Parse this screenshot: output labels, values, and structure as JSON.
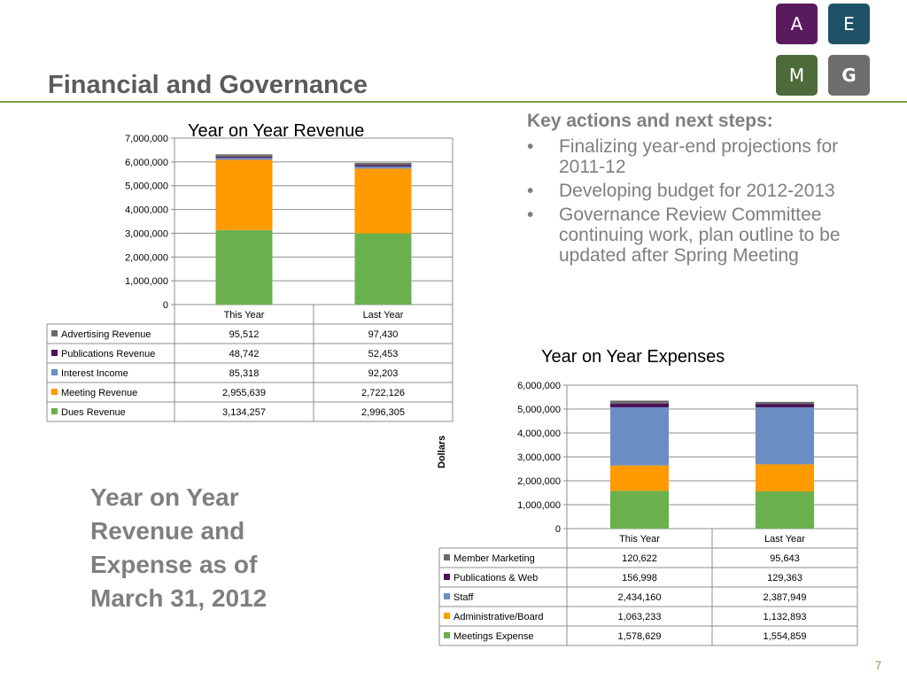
{
  "logo": {
    "tiles": [
      {
        "letter": "A",
        "color": "#5a1a5e"
      },
      {
        "letter": "E",
        "color": "#1f5268"
      },
      {
        "letter": "M",
        "color": "#4d6b3a"
      },
      {
        "letter": "G",
        "color": "#6e6e6e"
      }
    ]
  },
  "page": {
    "title": "Financial and Governance",
    "page_number": "7",
    "accent_color": "#77a33f"
  },
  "key_actions": {
    "heading": "Key actions and next steps:",
    "bullets": [
      "Finalizing year-end projections for 2011-12",
      "Developing budget for 2012-2013",
      "Governance Review Committee continuing work, plan outline to be updated after Spring Meeting"
    ]
  },
  "caption": "Year on Year Revenue and Expense as of March 31, 2012",
  "chart_data": [
    {
      "type": "bar",
      "stacked": true,
      "title": "Year on Year Revenue",
      "ylabel": "",
      "xlabel": "",
      "ylim": [
        0,
        7000000
      ],
      "yticks": [
        0,
        1000000,
        2000000,
        3000000,
        4000000,
        5000000,
        6000000,
        7000000
      ],
      "ytick_labels": [
        "0",
        "1,000,000",
        "2,000,000",
        "3,000,000",
        "4,000,000",
        "5,000,000",
        "6,000,000",
        "7,000,000"
      ],
      "grid": true,
      "legend": "data-table",
      "categories": [
        "This Year",
        "Last Year"
      ],
      "series": [
        {
          "name": "Dues Revenue",
          "color": "#6ab04c",
          "values": [
            3134257,
            2996305
          ],
          "labels": [
            "3,134,257",
            "2,996,305"
          ]
        },
        {
          "name": "Meeting Revenue",
          "color": "#ff9a00",
          "values": [
            2955639,
            2722126
          ],
          "labels": [
            "2,955,639",
            "2,722,126"
          ]
        },
        {
          "name": "Interest Income",
          "color": "#6a8dc3",
          "values": [
            85318,
            92203
          ],
          "labels": [
            "85,318",
            "92,203"
          ]
        },
        {
          "name": "Publications Revenue",
          "color": "#4b1055",
          "values": [
            48742,
            52453
          ],
          "labels": [
            "48,742",
            "52,453"
          ]
        },
        {
          "name": "Advertising Revenue",
          "color": "#6b6b6b",
          "values": [
            95512,
            97430
          ],
          "labels": [
            "95,512",
            "97,430"
          ]
        }
      ]
    },
    {
      "type": "bar",
      "stacked": true,
      "title": "Year on Year Expenses",
      "ylabel": "Dollars",
      "xlabel": "",
      "ylim": [
        0,
        6000000
      ],
      "yticks": [
        0,
        1000000,
        2000000,
        3000000,
        4000000,
        5000000,
        6000000
      ],
      "ytick_labels": [
        "0",
        "1,000,000",
        "2,000,000",
        "3,000,000",
        "4,000,000",
        "5,000,000",
        "6,000,000"
      ],
      "grid": true,
      "legend": "data-table",
      "categories": [
        "This Year",
        "Last Year"
      ],
      "series": [
        {
          "name": "Meetings Expense",
          "color": "#6ab04c",
          "values": [
            1578629,
            1554859
          ],
          "labels": [
            "1,578,629",
            "1,554,859"
          ]
        },
        {
          "name": "Administrative/Board",
          "color": "#ff9a00",
          "values": [
            1063233,
            1132893
          ],
          "labels": [
            "1,063,233",
            "1,132,893"
          ]
        },
        {
          "name": "Staff",
          "color": "#6a8dc3",
          "values": [
            2434160,
            2387949
          ],
          "labels": [
            "2,434,160",
            "2,387,949"
          ]
        },
        {
          "name": "Publications & Web",
          "color": "#4b1055",
          "values": [
            156998,
            129363
          ],
          "labels": [
            "156,998",
            "129,363"
          ]
        },
        {
          "name": "Member Marketing",
          "color": "#6b6b6b",
          "values": [
            120622,
            95643
          ],
          "labels": [
            "120,622",
            "95,643"
          ]
        }
      ]
    }
  ]
}
